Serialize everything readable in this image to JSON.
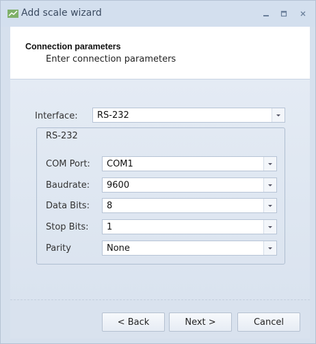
{
  "window": {
    "title": "Add scale wizard",
    "icon": "scale-app-icon"
  },
  "header": {
    "title": "Connection parameters",
    "subtitle": "Enter connection parameters"
  },
  "interface": {
    "label": "Interface:",
    "value": "RS-232"
  },
  "rs232": {
    "group_label": "RS-232",
    "fields": [
      {
        "label": "COM Port:",
        "value": "COM1"
      },
      {
        "label": "Baudrate:",
        "value": "9600"
      },
      {
        "label": "Data Bits:",
        "value": "8"
      },
      {
        "label": "Stop Bits:",
        "value": "1"
      },
      {
        "label": "Parity",
        "value": "None"
      }
    ]
  },
  "buttons": {
    "back": "< Back",
    "next": "Next >",
    "cancel": "Cancel"
  }
}
